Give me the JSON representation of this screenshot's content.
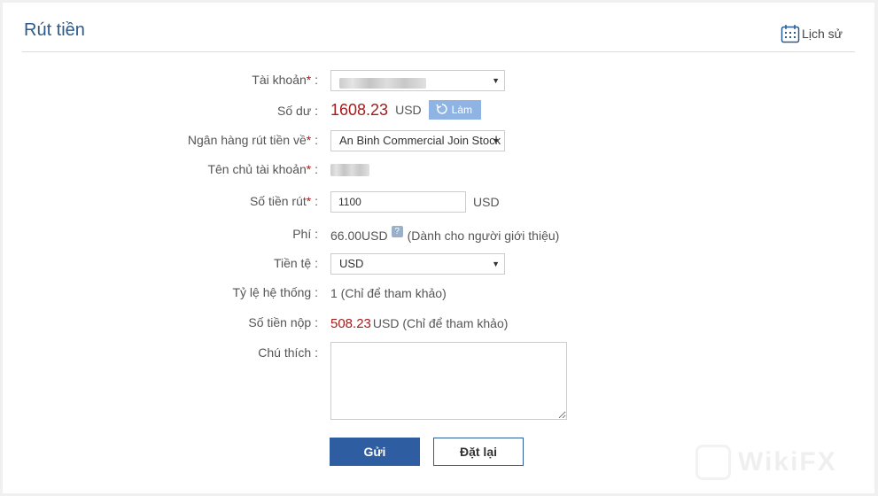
{
  "header": {
    "title": "Rút tiền",
    "history_label": "Lịch sử"
  },
  "form": {
    "account": {
      "label": "Tài khoản",
      "required_mark": "*",
      "colon": ":"
    },
    "balance": {
      "label": "Số dư",
      "colon": ":",
      "amount": "1608.23",
      "unit": "USD",
      "refresh_label": "Làm"
    },
    "bank": {
      "label": "Ngân hàng rút tiền về",
      "required_mark": "*",
      "colon": ":",
      "value": "An Binh Commercial Join Stock"
    },
    "holder": {
      "label": "Tên chủ tài khoản",
      "required_mark": "*",
      "colon": ":"
    },
    "amount": {
      "label": "Số tiền rút",
      "required_mark": "*",
      "colon": ":",
      "value": "1100",
      "unit": "USD"
    },
    "fee": {
      "label": "Phí",
      "colon": ":",
      "value": "66.00USD",
      "help_glyph": "?",
      "note": "(Dành cho người giới thiệu)"
    },
    "currency": {
      "label": "Tiền tệ",
      "colon": ":",
      "value": "USD"
    },
    "rate": {
      "label": "Tỷ lệ hệ thống",
      "colon": ":",
      "value": "1 (Chỉ để tham khảo)"
    },
    "deposit": {
      "label": "Số tiền nộp",
      "colon": ":",
      "amount": "508.23",
      "suffix": "USD (Chỉ để tham khảo)"
    },
    "note": {
      "label": "Chú thích",
      "colon": ":",
      "value": ""
    }
  },
  "actions": {
    "submit_label": "Gửi",
    "reset_label": "Đặt lại"
  },
  "icons": {
    "calendar": "calendar-icon",
    "refresh": "refresh-icon",
    "caret": "chevron-down-icon",
    "help": "help-icon"
  },
  "colors": {
    "title": "#2b5a8c",
    "amount_red": "#a51c1c",
    "primary_button": "#2e5ea1",
    "refresh_button": "#8fb4e3"
  }
}
